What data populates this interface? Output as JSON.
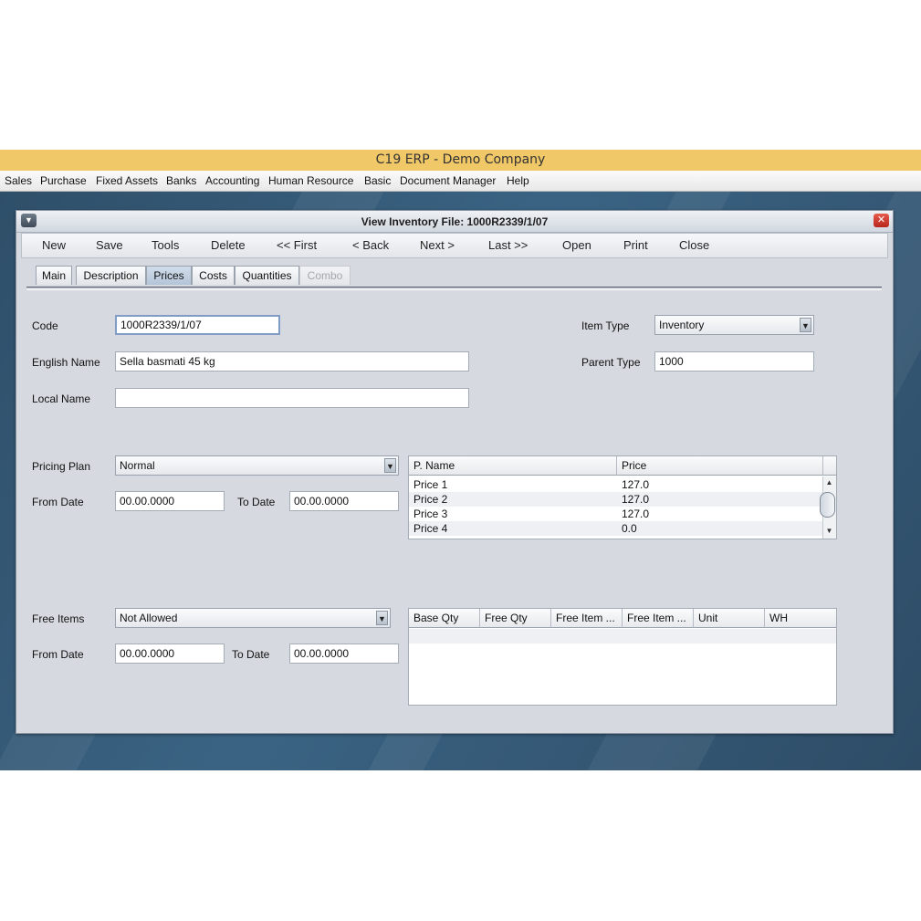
{
  "app": {
    "title": "C19 ERP - Demo Company",
    "menu": [
      "Sales",
      "Purchase",
      "Fixed Assets",
      "Banks",
      "Accounting",
      "Human Resource",
      "Basic",
      "Document Manager",
      "Help"
    ]
  },
  "window": {
    "title": "View Inventory File: 1000R2339/1/07",
    "close_glyph": "✕",
    "menu_glyph": "▼"
  },
  "toolbar": [
    "New",
    "Save",
    "Tools",
    "Delete",
    "<< First",
    "< Back",
    "Next >",
    "Last >>",
    "Open",
    "Print",
    "Close"
  ],
  "tabs": [
    {
      "label": "Main",
      "state": "normal"
    },
    {
      "label": "Description",
      "state": "normal"
    },
    {
      "label": "Prices",
      "state": "active"
    },
    {
      "label": "Costs",
      "state": "normal"
    },
    {
      "label": "Quantities",
      "state": "normal"
    },
    {
      "label": "Combo",
      "state": "disabled"
    }
  ],
  "form": {
    "code_label": "Code",
    "code_value": "1000R2339/1/07",
    "english_name_label": "English Name",
    "english_name_value": "Sella basmati 45 kg",
    "local_name_label": "Local Name",
    "local_name_value": "",
    "item_type_label": "Item Type",
    "item_type_value": "Inventory",
    "parent_type_label": "Parent Type",
    "parent_type_value": "1000"
  },
  "pricing": {
    "plan_label": "Pricing Plan",
    "plan_value": "Normal",
    "from_date_label": "From Date",
    "from_date_value": "00.00.0000",
    "to_date_label": "To Date",
    "to_date_value": "00.00.0000",
    "table": {
      "headers": [
        "P. Name",
        "Price"
      ],
      "rows": [
        [
          "Price 1",
          "127.0"
        ],
        [
          "Price 2",
          "127.0"
        ],
        [
          "Price 3",
          "127.0"
        ],
        [
          "Price 4",
          "0.0"
        ]
      ]
    }
  },
  "free_items": {
    "label": "Free Items",
    "value": "Not Allowed",
    "from_date_label": "From Date",
    "from_date_value": "00.00.0000",
    "to_date_label": "To Date",
    "to_date_value": "00.00.0000",
    "table": {
      "headers": [
        "Base Qty",
        "Free Qty",
        "Free Item ...",
        "Free Item ...",
        "Unit",
        "WH"
      ]
    }
  },
  "icons": {
    "dropdown": "▼",
    "scroll_up": "▲",
    "scroll_down": "▼"
  },
  "colors": {
    "titlebar": "#f0c868",
    "desktop": "#2f4f69",
    "window_bg": "#d6d9df",
    "active_tab": "#b4c4d8"
  }
}
